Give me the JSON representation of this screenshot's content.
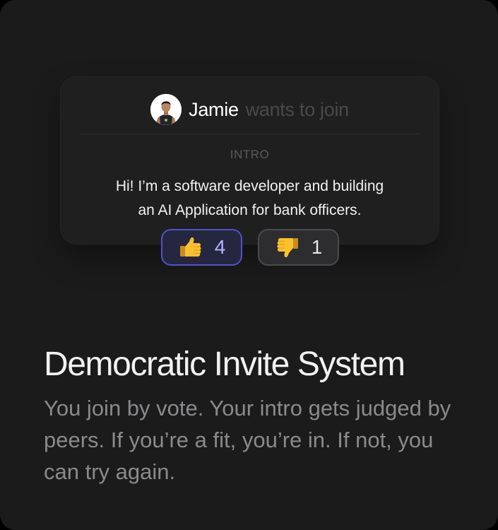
{
  "card": {
    "user_name": "Jamie",
    "join_text": "wants to join",
    "intro_label": "INTRO",
    "intro_line1": "Hi! I’m a software developer and building",
    "intro_line2": "an AI Application for bank officers."
  },
  "votes": {
    "up": {
      "icon": "thumbs-up-icon",
      "count": "4"
    },
    "down": {
      "icon": "thumbs-down-icon",
      "count": "1"
    }
  },
  "feature": {
    "title": "Democratic Invite System",
    "description": "You join by vote. Your intro gets judged by peers. If you’re a fit, you’re in. If not, you can try again."
  },
  "colors": {
    "background": "#1b1b1c",
    "card": "#1f1f20",
    "accent": "#5352c6",
    "upvote_text": "#b3b4ff",
    "muted": "#8a8a8c"
  }
}
